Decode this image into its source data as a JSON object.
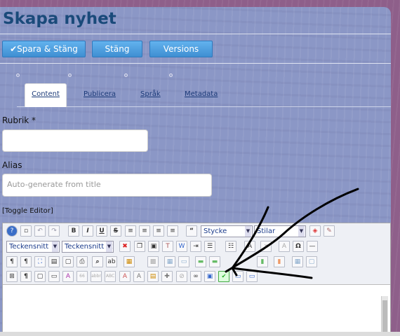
{
  "title": "Skapa nyhet",
  "buttons": {
    "save_close": "✔Spara & Stäng",
    "close": "Stäng",
    "versions": "Versions"
  },
  "tabs": [
    "Content",
    "Publicera",
    "Språk",
    "Metadata"
  ],
  "fields": {
    "rubrik_label": "Rubrik *",
    "alias_label": "Alias",
    "alias_placeholder": "Auto-generate from title"
  },
  "toggle_editor": "[Toggle Editor]",
  "toolbar": {
    "row1_icons": [
      "help-icon",
      "new-document-icon",
      "undo-icon",
      "redo-icon",
      "bold-icon",
      "italic-icon",
      "underline-icon",
      "strikethrough-icon",
      "justify-full-icon",
      "align-center-icon",
      "align-left-icon",
      "align-right-icon",
      "blockquote-icon"
    ],
    "row1_labels": [
      "B",
      "I",
      "U",
      "S"
    ],
    "style_select": "Stycke",
    "styles_select": "Stilar",
    "font_select": "Teckensnitt",
    "font_size_select": "Teckensnitt sto",
    "spellcheck_icon": "spellcheck-icon"
  }
}
